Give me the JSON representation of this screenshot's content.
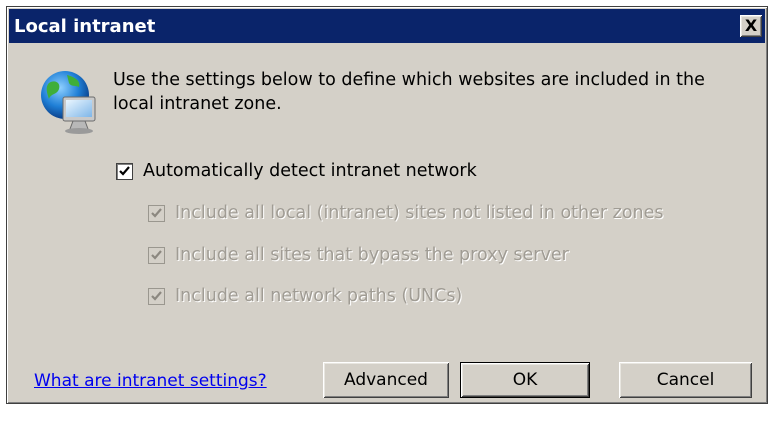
{
  "window": {
    "title": "Local intranet",
    "close_label": "X"
  },
  "intro": {
    "text": "Use the settings below to define which websites are included in the local intranet zone."
  },
  "options": {
    "auto_detect": {
      "label": "Automatically detect intranet network",
      "checked": true,
      "enabled": true
    },
    "include_local": {
      "label": "Include all local (intranet) sites not listed in other zones",
      "checked": true,
      "enabled": false
    },
    "include_bypass": {
      "label": "Include all sites that bypass the proxy server",
      "checked": true,
      "enabled": false
    },
    "include_unc": {
      "label": "Include all network paths (UNCs)",
      "checked": true,
      "enabled": false
    }
  },
  "footer": {
    "link_text": "What are intranet settings?",
    "advanced_label": "Advanced",
    "ok_label": "OK",
    "cancel_label": "Cancel"
  },
  "colors": {
    "titlebar": "#0a246a",
    "dialog_face": "#d4d0c8",
    "link": "#0000ee",
    "disabled_text": "#a09c94"
  },
  "icons": {
    "zone_icon": "globe-monitor-icon",
    "close_icon": "close-icon",
    "checkmark": "checkmark-icon"
  }
}
